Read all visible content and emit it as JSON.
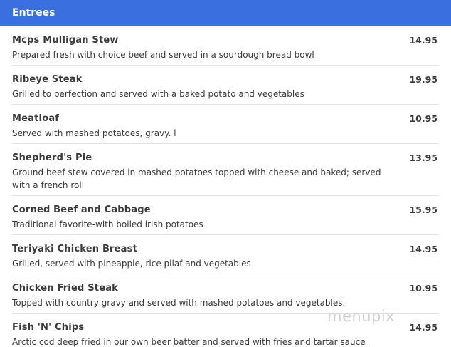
{
  "section": {
    "title": "Entrees"
  },
  "items": [
    {
      "name": "Mcps Mulligan Stew",
      "description": "Prepared fresh with choice beef and served in a sourdough bread bowl",
      "price": "14.95"
    },
    {
      "name": "Ribeye Steak",
      "description": "Grilled to perfection and served with a baked potato and vegetables",
      "price": "19.95"
    },
    {
      "name": "Meatloaf",
      "description": "Served with mashed potatoes, gravy. l",
      "price": "10.95"
    },
    {
      "name": "Shepherd's Pie",
      "description": "Ground beef stew covered in mashed potatoes topped with cheese and baked; served with a french roll",
      "price": "13.95"
    },
    {
      "name": "Corned Beef and Cabbage",
      "description": "Traditional favorite-with boiled irish potatoes",
      "price": "15.95"
    },
    {
      "name": "Teriyaki Chicken Breast",
      "description": "Grilled, served with pineapple, rice pilaf and vegetables",
      "price": "14.95"
    },
    {
      "name": "Chicken Fried Steak",
      "description": "Topped with country gravy and served with mashed potatoes and vegetables.",
      "price": "10.95"
    },
    {
      "name": "Fish 'N' Chips",
      "description": "Arctic cod deep fried in our own beer batter and served with fries and tartar sauce",
      "price": "14.95"
    }
  ],
  "watermark": {
    "text": "menupix"
  },
  "colors": {
    "header_bg": "#3a6fe0",
    "header_text": "#ffffff",
    "body_text": "#3a3a3a",
    "divider": "#e3e3e3"
  }
}
